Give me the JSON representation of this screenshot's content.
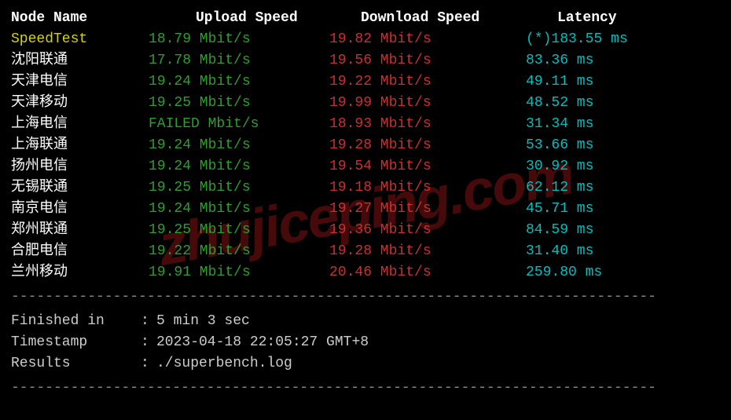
{
  "header": {
    "node_name": "Node Name",
    "upload": "Upload Speed",
    "download": "Download Speed",
    "latency": "Latency"
  },
  "rows": [
    {
      "node": "SpeedTest",
      "node_class": "node-speedtest",
      "upload": "18.79 Mbit/s",
      "download": "19.82 Mbit/s",
      "latency": "(*)183.55 ms"
    },
    {
      "node": "沈阳联通",
      "node_class": "node-cn",
      "upload": "17.78 Mbit/s",
      "download": "19.56 Mbit/s",
      "latency": "83.36 ms"
    },
    {
      "node": "天津电信",
      "node_class": "node-cn",
      "upload": "19.24 Mbit/s",
      "download": "19.22 Mbit/s",
      "latency": "49.11 ms"
    },
    {
      "node": "天津移动",
      "node_class": "node-cn",
      "upload": "19.25 Mbit/s",
      "download": "19.99 Mbit/s",
      "latency": "48.52 ms"
    },
    {
      "node": "上海电信",
      "node_class": "node-cn",
      "upload": "FAILED Mbit/s",
      "download": "18.93 Mbit/s",
      "latency": "31.34 ms"
    },
    {
      "node": "上海联通",
      "node_class": "node-cn",
      "upload": "19.24 Mbit/s",
      "download": "19.28 Mbit/s",
      "latency": "53.66 ms"
    },
    {
      "node": "扬州电信",
      "node_class": "node-cn",
      "upload": "19.24 Mbit/s",
      "download": "19.54 Mbit/s",
      "latency": "30.92 ms"
    },
    {
      "node": "无锡联通",
      "node_class": "node-cn",
      "upload": "19.25 Mbit/s",
      "download": "19.18 Mbit/s",
      "latency": "62.12 ms"
    },
    {
      "node": "南京电信",
      "node_class": "node-cn",
      "upload": "19.24 Mbit/s",
      "download": "19.27 Mbit/s",
      "latency": "45.71 ms"
    },
    {
      "node": "郑州联通",
      "node_class": "node-cn",
      "upload": "19.25 Mbit/s",
      "download": "19.36 Mbit/s",
      "latency": "84.59 ms"
    },
    {
      "node": "合肥电信",
      "node_class": "node-cn",
      "upload": "19.22 Mbit/s",
      "download": "19.28 Mbit/s",
      "latency": "31.40 ms"
    },
    {
      "node": "兰州移动",
      "node_class": "node-cn",
      "upload": "19.91 Mbit/s",
      "download": "20.46 Mbit/s",
      "latency": "259.80 ms"
    }
  ],
  "footer": {
    "finished_label": "Finished in",
    "finished_value": "5 min 3 sec",
    "timestamp_label": "Timestamp",
    "timestamp_value": "2023-04-18 22:05:27 GMT+8",
    "results_label": "Results",
    "results_value": "./superbench.log"
  },
  "divider": "----------------------------------------------------------------------------",
  "watermark": "zhujiceping.com",
  "chart_data": {
    "type": "table",
    "title": "SpeedTest Benchmark Results",
    "columns": [
      "Node Name",
      "Upload Speed (Mbit/s)",
      "Download Speed (Mbit/s)",
      "Latency (ms)"
    ],
    "data": [
      [
        "SpeedTest",
        18.79,
        19.82,
        183.55
      ],
      [
        "沈阳联通",
        17.78,
        19.56,
        83.36
      ],
      [
        "天津电信",
        19.24,
        19.22,
        49.11
      ],
      [
        "天津移动",
        19.25,
        19.99,
        48.52
      ],
      [
        "上海电信",
        null,
        18.93,
        31.34
      ],
      [
        "上海联通",
        19.24,
        19.28,
        53.66
      ],
      [
        "扬州电信",
        19.24,
        19.54,
        30.92
      ],
      [
        "无锡联通",
        19.25,
        19.18,
        62.12
      ],
      [
        "南京电信",
        19.24,
        19.27,
        45.71
      ],
      [
        "郑州联通",
        19.25,
        19.36,
        84.59
      ],
      [
        "合肥电信",
        19.22,
        19.28,
        31.4
      ],
      [
        "兰州移动",
        19.91,
        20.46,
        259.8
      ]
    ]
  }
}
